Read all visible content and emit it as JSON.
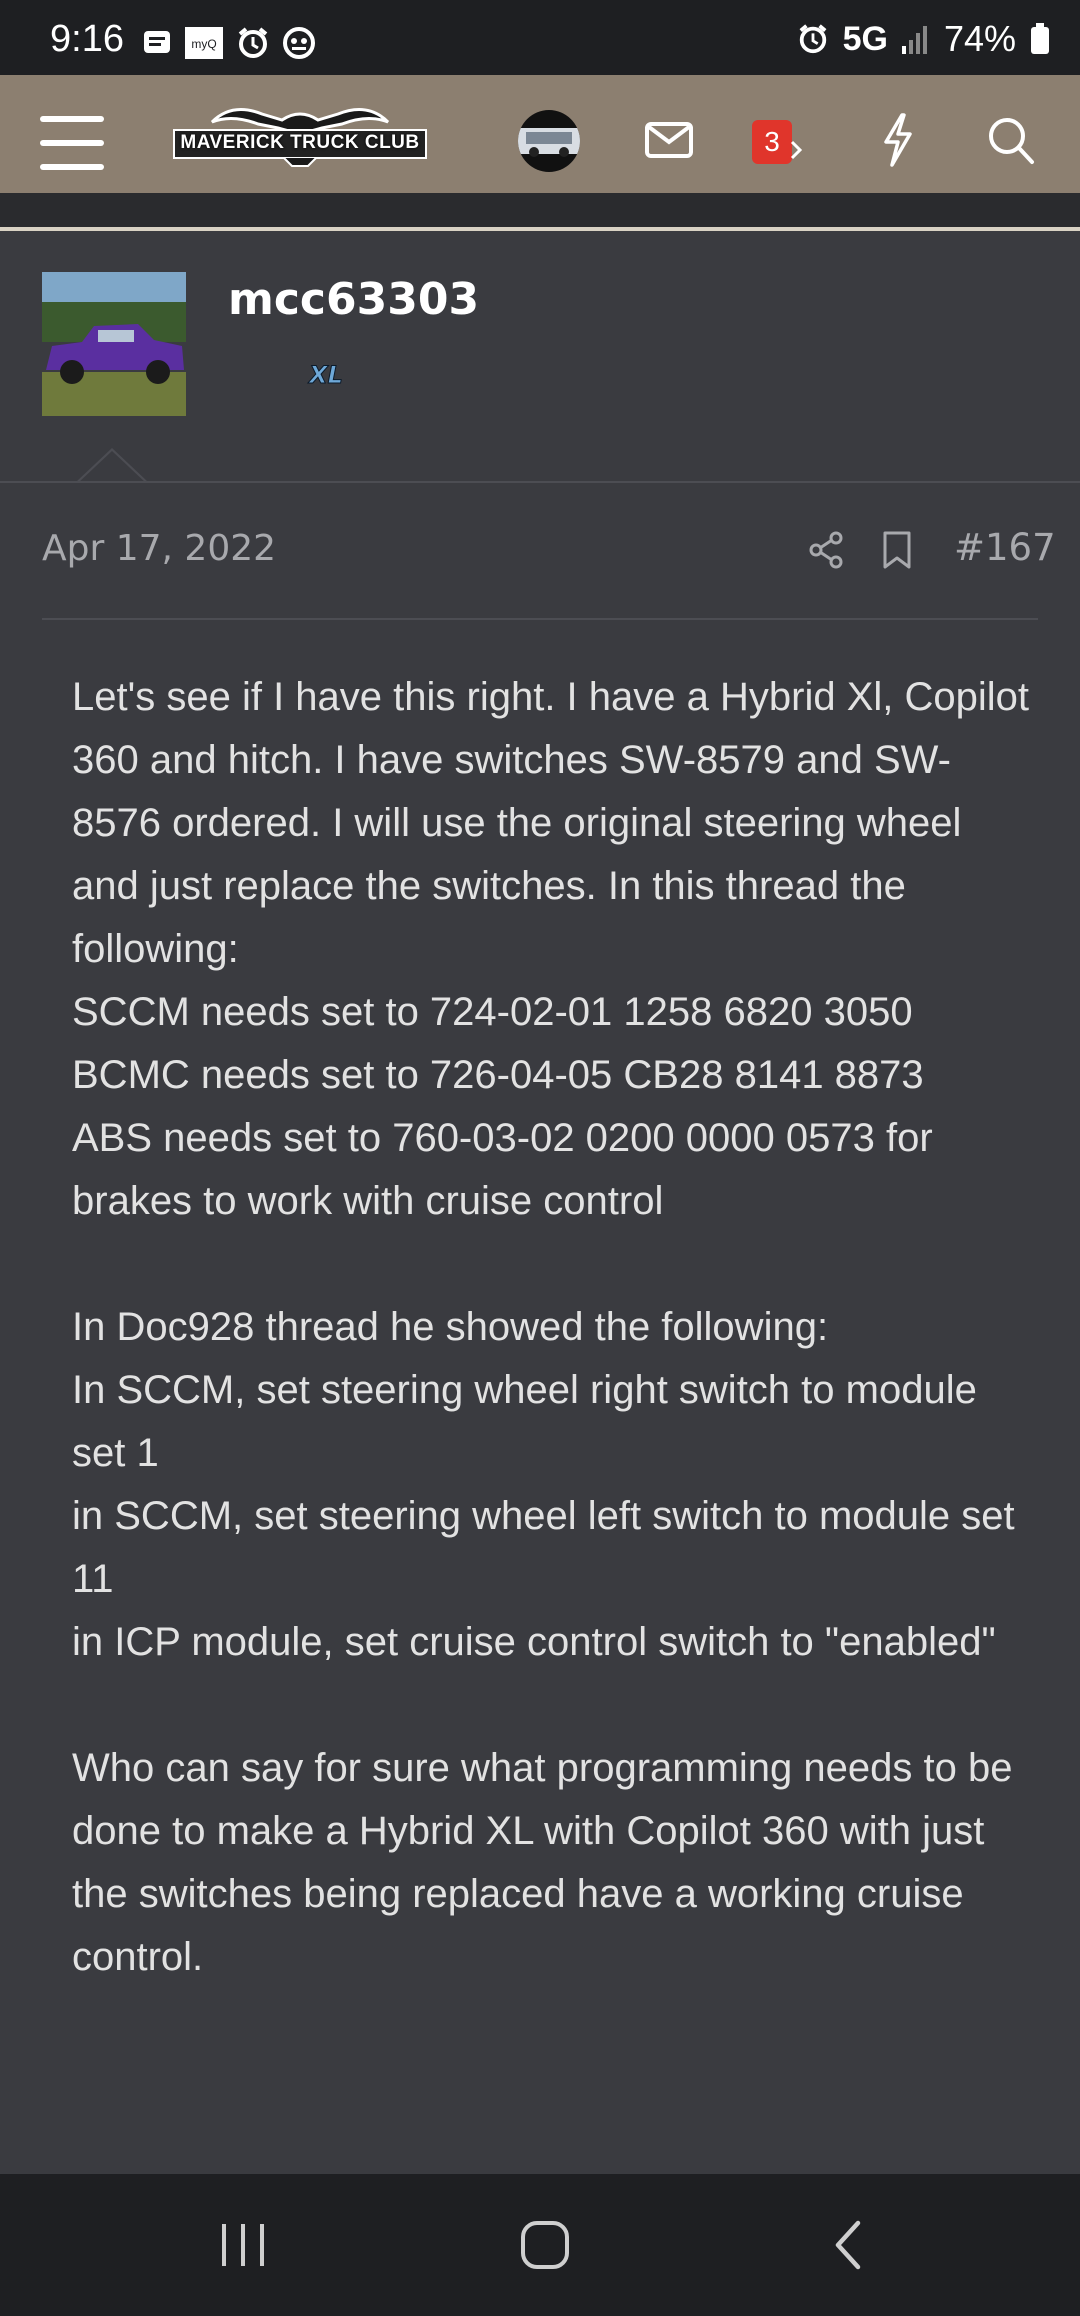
{
  "status_bar": {
    "time": "9:16",
    "left_icons": [
      "message-icon",
      "myq-icon",
      "alarm-icon",
      "game-icon"
    ],
    "myq_label": "myQ",
    "network": "5G",
    "battery": "74%"
  },
  "nav": {
    "logo_text": "MAVERICK TRUCK CLUB",
    "alerts_count": "3"
  },
  "post": {
    "username": "mcc63303",
    "user_badge": "XL",
    "date": "Apr 17, 2022",
    "number": "#167",
    "paragraphs": [
      "Let's see if I have this right. I have a Hybrid Xl, Copilot 360 and hitch. I have switches SW-8579 and SW-8576 ordered. I will use the original steering wheel and just replace the switches. In this thread the following:\nSCCM needs set to 724-02-01 1258 6820 3050\nBCMC needs set to 726-04-05 CB28 8141 8873\nABS needs set to 760-03-02 0200 0000 0573 for brakes to work with cruise control",
      "In Doc928 thread he showed the following:\nIn SCCM, set steering wheel right switch to module set 1\nin SCCM, set steering wheel left switch to module set 11\nin ICP module, set cruise control switch to \"enabled\"",
      "Who can say for sure what programming needs to be done to make a Hybrid XL with Copilot 360 with just the switches being replaced have a working cruise control."
    ]
  },
  "colors": {
    "background": "#3a3b40",
    "nav_bar": "#8c7f70",
    "badge": "#e0352b"
  }
}
